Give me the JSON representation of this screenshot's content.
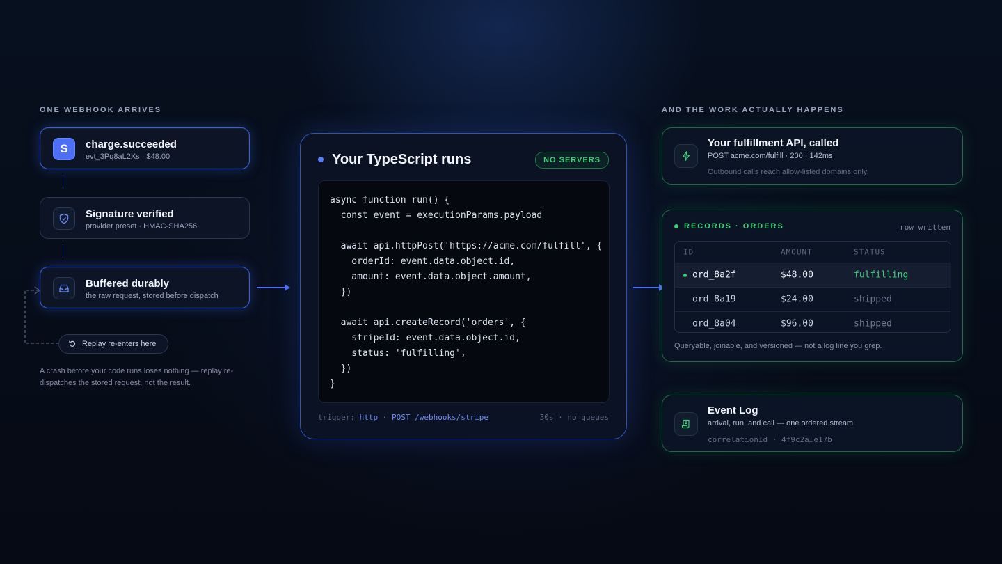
{
  "left": {
    "section_label": "ONE WEBHOOK ARRIVES",
    "steps": [
      {
        "title": "charge.succeeded",
        "sub": "evt_3Pq8aL2Xs · $48.00",
        "icon": "stripe-logo-icon"
      },
      {
        "title": "Signature verified",
        "sub": "provider preset · HMAC-SHA256",
        "icon": "shield-check-icon"
      },
      {
        "title": "Buffered durably",
        "sub": "the raw request, stored before dispatch",
        "icon": "inbox-icon"
      }
    ],
    "stripe_letter": "S",
    "replay_label": "Replay re-enters here",
    "note": "A crash before your code runs loses nothing — replay re-dispatches the stored request, not the result."
  },
  "center": {
    "title": "Your TypeScript runs",
    "badge": "NO SERVERS",
    "code_lines": [
      "async function run() {",
      "  const event = executionParams.payload",
      "",
      "  await api.httpPost('https://acme.com/fulfill', {",
      "    orderId: event.data.object.id,",
      "    amount: event.data.object.amount,",
      "  })",
      "",
      "  await api.createRecord('orders', {",
      "    stripeId: event.data.object.id,",
      "    status: 'fulfilling',",
      "  })",
      "}"
    ],
    "trigger_label": "trigger:",
    "trigger_value": "http · POST /webhooks/stripe",
    "meta": "30s · no queues"
  },
  "right": {
    "section_label": "AND THE WORK ACTUALLY HAPPENS",
    "api_card": {
      "title": "Your fulfillment API, called",
      "sub": "POST acme.com/fulfill · 200 · 142ms",
      "note": "Outbound calls reach allow-listed domains only."
    },
    "records": {
      "title": "RECORDS · ORDERS",
      "status": "row written",
      "columns": [
        "ID",
        "AMOUNT",
        "STATUS"
      ],
      "rows": [
        {
          "id": "ord_8a2f",
          "amount": "$48.00",
          "status": "fulfilling"
        },
        {
          "id": "ord_8a19",
          "amount": "$24.00",
          "status": "shipped"
        },
        {
          "id": "ord_8a04",
          "amount": "$96.00",
          "status": "shipped"
        }
      ],
      "footer": "Queryable, joinable, and versioned — not a log line you grep."
    },
    "event_log": {
      "title": "Event Log",
      "sub": "arrival, run, and call — one ordered stream",
      "meta": "correlationId · 4f9c2a…e17b"
    }
  },
  "colors": {
    "accent_blue": "#4d6ef5",
    "accent_green": "#3fd07a",
    "background": "#060a14"
  }
}
